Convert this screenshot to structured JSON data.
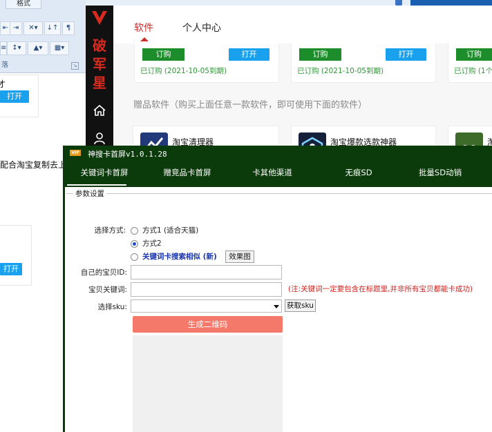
{
  "word_bg": {
    "ribbon_tab": "格式",
    "ribbon_group": "落",
    "doc_button_1": "打开",
    "doc_button_2": "打开",
    "doc_text": "配合淘宝复制去上",
    "doc_cursor_char": "才"
  },
  "app": {
    "logo_chars": [
      "破",
      "军",
      "星"
    ],
    "nav_tabs": [
      "软件",
      "个人中心"
    ],
    "subscribe_cards": [
      {
        "order_label": "订购",
        "open_label": "打开",
        "status": "已订购 (2021-10-05到期)"
      },
      {
        "order_label": "订购",
        "open_label": "打开",
        "status": "已订购 (2021-10-05到期)"
      },
      {
        "order_label": "订购",
        "status": "已订购 (1个"
      }
    ],
    "gift_heading": "赠品软件（购买上面任意一款软件，即可使用下面的软件）",
    "gift_apps": [
      {
        "name": "淘宝清理器"
      },
      {
        "name": "淘宝爆款选款神器"
      },
      {
        "name": "淘"
      }
    ]
  },
  "dialog": {
    "vip_badge": "VIP",
    "title": "神搜卡首屏v1.0.1.28",
    "tabs": [
      "关键词卡首屏",
      "赠竞品卡首屏",
      "卡其他渠道",
      "无痕SD",
      "批量SD动销"
    ],
    "active_tab": 0,
    "group_legend": "参数设置",
    "choose_method_label": "选择方式:",
    "options": [
      {
        "label": "方式1 (适合天猫)",
        "checked": false
      },
      {
        "label": "方式2",
        "checked": true
      },
      {
        "label": "关键词卡搜索相似 (新)",
        "checked": false
      }
    ],
    "effect_button": "效果图",
    "own_item_id_label": "自己的宝贝ID:",
    "own_item_id_value": "",
    "keyword_label": "宝贝关键词:",
    "keyword_value": "",
    "keyword_warning": "(注:关键词一定要包含在标题里,并非所有宝贝都能卡成功)",
    "sku_label": "选择sku:",
    "sku_value": "",
    "get_sku_button": "获取sku",
    "generate_button": "生成二维码"
  },
  "colors": {
    "dialog_bg": "#0b3a0b",
    "generate_button": "#f4796b",
    "warning_text": "#d2231f",
    "link_text": "#1836b0",
    "app_green_button": "#1c8d2a",
    "app_blue_button": "#1aa1ee",
    "brand_red": "#c9302c"
  }
}
